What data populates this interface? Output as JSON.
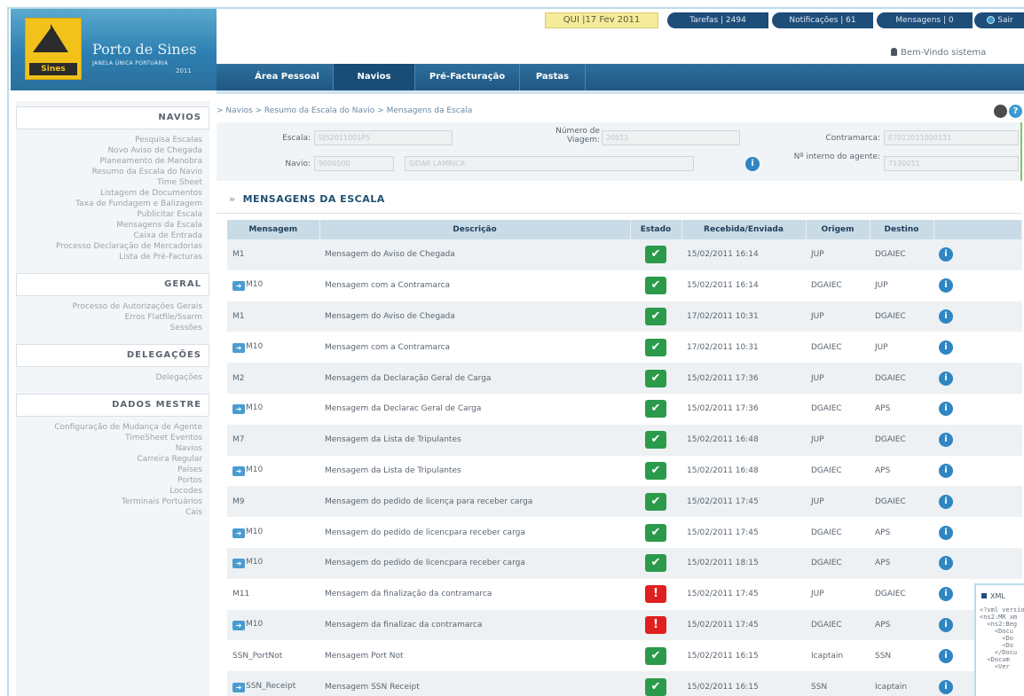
{
  "brand": {
    "logo_text": "Sines",
    "title": "Porto de Sines",
    "subtitle": "JANELA ÚNICA PORTUÁRIA",
    "version": "2011"
  },
  "topbar": {
    "date": "QUI |17 Fev 2011",
    "tarefas": "Tarefas | 2494",
    "notificacoes": "Notificações | 61",
    "mensagens": "Mensagens | 0",
    "sair": "Sair"
  },
  "welcome": "Bem-Vindo sistema",
  "nav": [
    "Área Pessoal",
    "Navios",
    "Pré-Facturação",
    "Pastas"
  ],
  "sidebar": {
    "sections": [
      {
        "title": "NAVIOS",
        "items": [
          "Pesquisa Escalas",
          "Novo Aviso de Chegada",
          "Planeamento de Manobra",
          "Resumo da Escala do Navio",
          "Time Sheet",
          "Listagem de Documentos",
          "Taxa de Fundagem e Balizagem",
          "Publicitar Escala",
          "Mensagens da Escala",
          "Caixa de Entrada",
          "Processo Declaração de Mercadorias",
          "Lista de Pré-Facturas"
        ]
      },
      {
        "title": "GERAL",
        "items": [
          "Processo de Autorizações Gerais",
          "Erros Flatfile/Ssarm",
          "Sessões"
        ]
      },
      {
        "title": "DELEGAÇÕES",
        "items": [
          "Delegações"
        ]
      },
      {
        "title": "DADOS MESTRE",
        "items": [
          "Configuração de Mudança de Agente",
          "TimeSheet Eventos",
          "Navios",
          "Carreira Regular",
          "Países",
          "Portos",
          "Locodes",
          "Terminais Portuários",
          "Cais"
        ]
      }
    ]
  },
  "breadcrumb": "> Navios > Resumo da Escala do Navio > Mensagens da Escala",
  "form": {
    "escala_label": "Escala:",
    "escala_value": "SJ52011001P5",
    "viagem_label": "Número de Viagem:",
    "viagem_value": "20011",
    "contramarca_label": "Contramarca:",
    "contramarca_value": "E7012011000131",
    "navio_label": "Navio:",
    "navio_code": "9006500",
    "navio_name": "SIDAR LAMRICA",
    "interno_label": "Nº interno do agente:",
    "interno_value": "7130011"
  },
  "section_title": "MENSAGENS DA ESCALA",
  "table": {
    "headers": [
      "Mensagem",
      "Descrição",
      "Estado",
      "Recebida/Enviada",
      "Origem",
      "Destino",
      ""
    ],
    "rows": [
      {
        "msg": "M1",
        "fwd": false,
        "desc": "Mensagem do Aviso de Chegada",
        "status": "ok",
        "date": "15/02/2011 16:14",
        "orig": "JUP",
        "dest": "DGAIEC"
      },
      {
        "msg": "M10",
        "fwd": true,
        "desc": "Mensagem com a Contramarca",
        "status": "ok",
        "date": "15/02/2011 16:14",
        "orig": "DGAIEC",
        "dest": "JUP"
      },
      {
        "msg": "M1",
        "fwd": false,
        "desc": "Mensagem do Aviso de Chegada",
        "status": "ok",
        "date": "17/02/2011 10:31",
        "orig": "JUP",
        "dest": "DGAIEC"
      },
      {
        "msg": "M10",
        "fwd": true,
        "desc": "Mensagem com a Contramarca",
        "status": "ok",
        "date": "17/02/2011 10:31",
        "orig": "DGAIEC",
        "dest": "JUP"
      },
      {
        "msg": "M2",
        "fwd": false,
        "desc": "Mensagem da Declaração Geral de Carga",
        "status": "ok",
        "date": "15/02/2011 17:36",
        "orig": "JUP",
        "dest": "DGAIEC"
      },
      {
        "msg": "M10",
        "fwd": true,
        "desc": "Mensagem da Declarac Geral de Carga",
        "status": "ok",
        "date": "15/02/2011 17:36",
        "orig": "DGAIEC",
        "dest": "APS"
      },
      {
        "msg": "M7",
        "fwd": false,
        "desc": "Mensagem da Lista de Tripulantes",
        "status": "ok",
        "date": "15/02/2011 16:48",
        "orig": "JUP",
        "dest": "DGAIEC"
      },
      {
        "msg": "M10",
        "fwd": true,
        "desc": "Mensagem da Lista de Tripulantes",
        "status": "ok",
        "date": "15/02/2011 16:48",
        "orig": "DGAIEC",
        "dest": "APS"
      },
      {
        "msg": "M9",
        "fwd": false,
        "desc": "Mensagem do pedido de licença para receber carga",
        "status": "ok",
        "date": "15/02/2011 17:45",
        "orig": "JUP",
        "dest": "DGAIEC"
      },
      {
        "msg": "M10",
        "fwd": true,
        "desc": "Mensagem do pedido de licencpara receber carga",
        "status": "ok",
        "date": "15/02/2011 17:45",
        "orig": "DGAIEC",
        "dest": "APS"
      },
      {
        "msg": "M10",
        "fwd": true,
        "desc": "Mensagem do pedido de licencpara receber carga",
        "status": "ok",
        "date": "15/02/2011 18:15",
        "orig": "DGAIEC",
        "dest": "APS"
      },
      {
        "msg": "M11",
        "fwd": false,
        "desc": "Mensagem da finalização da contramarca",
        "status": "error",
        "date": "15/02/2011 17:45",
        "orig": "JUP",
        "dest": "DGAIEC"
      },
      {
        "msg": "M10",
        "fwd": true,
        "desc": "Mensagem da finalizac da contramarca",
        "status": "error",
        "date": "15/02/2011 17:45",
        "orig": "DGAIEC",
        "dest": "APS"
      },
      {
        "msg": "SSN_PortNot",
        "fwd": false,
        "desc": "Mensagem Port Not",
        "status": "ok",
        "date": "15/02/2011 16:15",
        "orig": "Icaptain",
        "dest": "SSN"
      },
      {
        "msg": "SSN_Receipt",
        "fwd": true,
        "desc": "Mensagem SSN Receipt",
        "status": "ok",
        "date": "15/02/2011 16:15",
        "orig": "SSN",
        "dest": "Icaptain"
      }
    ]
  },
  "xml_panel": {
    "title": "XML",
    "lines": [
      "<?xml versio",
      "<ns2:MR xm",
      "  <ns2:Beg",
      "    <Docu",
      "      <Do",
      "      <Do",
      "    </Docu",
      "  <Docum",
      "    <Ver"
    ]
  }
}
